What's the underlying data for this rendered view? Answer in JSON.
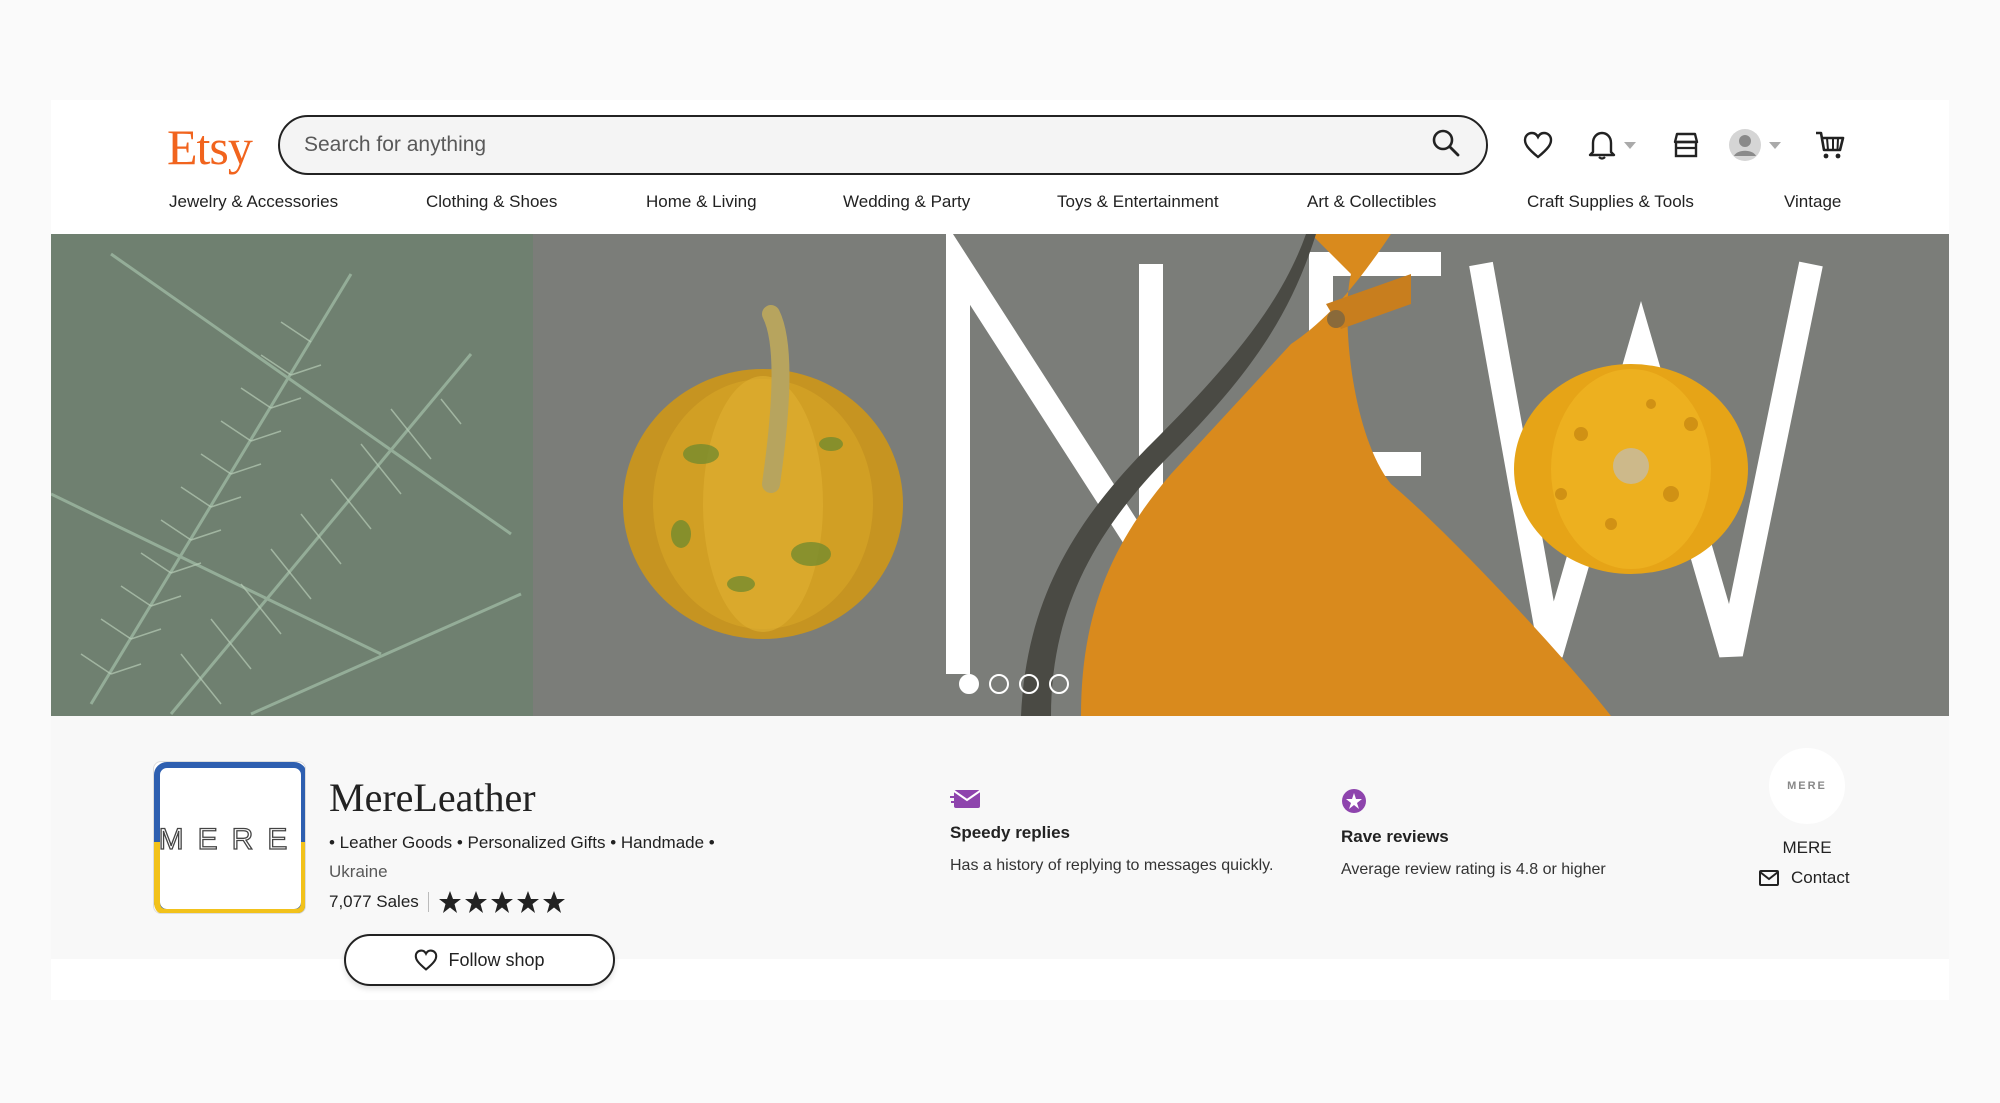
{
  "header": {
    "logo": "Etsy",
    "search_placeholder": "Search for anything"
  },
  "nav": [
    "Jewelry & Accessories",
    "Clothing & Shoes",
    "Home & Living",
    "Wedding & Party",
    "Toys & Entertainment",
    "Art & Collectibles",
    "Craft Supplies & Tools",
    "Vintage"
  ],
  "banner": {
    "text": "NEW",
    "slides": 4,
    "active_slide": 1
  },
  "shop": {
    "logo_text": "MERE",
    "name": "MereLeather",
    "tags": "• Leather Goods • Personalized Gifts • Handmade •",
    "location": "Ukraine",
    "sales": "7,077 Sales",
    "rating_stars": 5,
    "follow_label": "Follow shop"
  },
  "badges": [
    {
      "icon": "envelope-icon",
      "title": "Speedy replies",
      "desc": "Has a history of replying to messages quickly."
    },
    {
      "icon": "star-badge-icon",
      "title": "Rave reviews",
      "desc": "Average review rating is 4.8 or higher"
    }
  ],
  "owner": {
    "avatar_text": "MERE",
    "name": "MERE",
    "contact_label": "Contact"
  },
  "colors": {
    "brand": "#f1641e",
    "badge_purple": "#8e44ad",
    "banner_gray": "#7b8077"
  }
}
